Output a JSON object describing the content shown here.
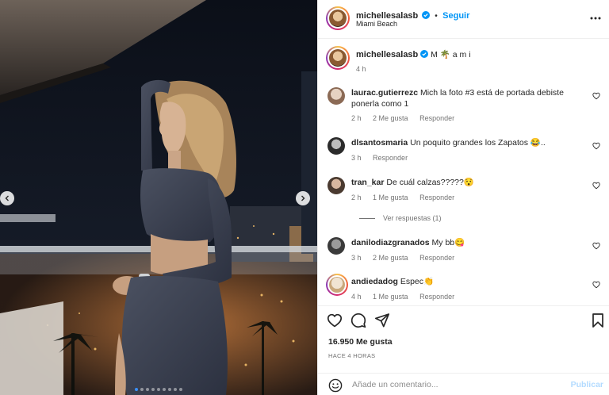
{
  "post": {
    "author": "michellesalasb",
    "follow_label": "Seguir",
    "separator": "•",
    "location": "Miami Beach",
    "caption": "M 🌴 a m i",
    "caption_time": "4 h",
    "likes": "16.950 Me gusta",
    "time_ago": "HACE 4 HORAS",
    "carousel": {
      "total": 9,
      "active": 1
    }
  },
  "comments": [
    {
      "user": "laurac.gutierrezc",
      "text": "Mich la foto #3 está de portada debiste ponerla como 1",
      "time": "2 h",
      "likes": "2 Me gusta",
      "reply": "Responder"
    },
    {
      "user": "dlsantosmaria",
      "text": "Un poquito grandes los Zapatos 😂..",
      "time": "3 h",
      "likes": "",
      "reply": "Responder"
    },
    {
      "user": "tran_kar",
      "text": "De cuál calzas?????😯",
      "time": "2 h",
      "likes": "1 Me gusta",
      "reply": "Responder",
      "view_replies": "Ver respuestas (1)"
    },
    {
      "user": "danilodiazgranados",
      "text": "My bb😋",
      "time": "3 h",
      "likes": "2 Me gusta",
      "reply": "Responder"
    },
    {
      "user": "andiedadog",
      "text": "Espec👏",
      "time": "4 h",
      "likes": "1 Me gusta",
      "reply": "Responder"
    }
  ],
  "composer": {
    "placeholder": "Añade un comentario...",
    "publish_label": "Publicar"
  },
  "colors": {
    "link_blue": "#0095f6",
    "publish_disabled": "#b3dbff",
    "muted": "#737373"
  }
}
